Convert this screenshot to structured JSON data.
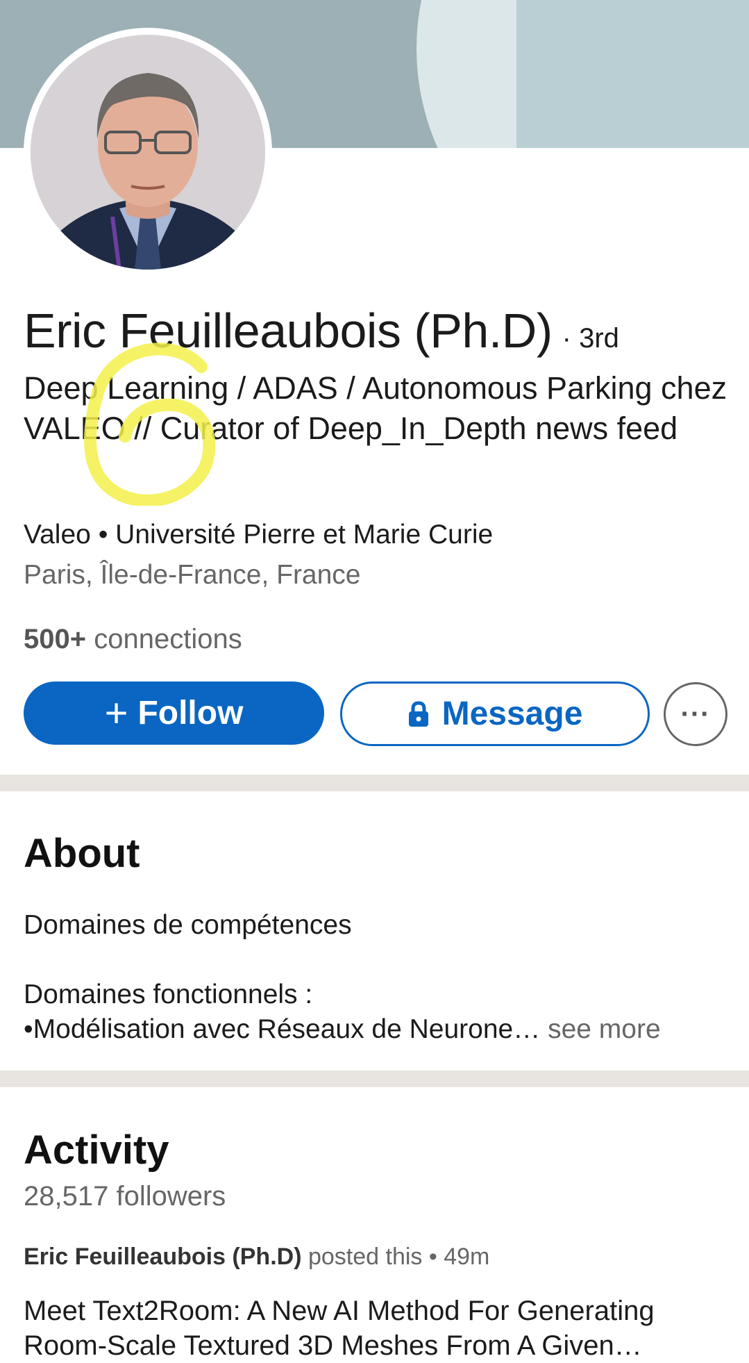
{
  "profile": {
    "name": "Eric Feuilleaubois (Ph.D)",
    "degree": "· 3rd",
    "headline": "Deep Learning / ADAS / Autonomous Parking chez VALEO // Curator of Deep_In_Depth news feed",
    "orgs": "Valeo • Université Pierre et Marie Curie",
    "location": "Paris, Île-de-France, France",
    "connections_count": "500+",
    "connections_label": "connections"
  },
  "actions": {
    "follow_icon": "+",
    "follow_label": "Follow",
    "message_label": "Message",
    "more_label": "···"
  },
  "icons": {
    "follow": "plus-icon",
    "message": "lock-icon",
    "more": "ellipsis-icon"
  },
  "about": {
    "title": "About",
    "line1": "Domaines de compétences",
    "line2": "Domaines fonctionnels :",
    "line3": "•Modélisation avec Réseaux de Neurone…",
    "see_more": "see more"
  },
  "activity": {
    "title": "Activity",
    "followers": "28,517 followers",
    "post_author": "Eric Feuilleaubois (Ph.D)",
    "post_meta": "posted this • 49m",
    "post_text": "Meet Text2Room: A New AI Method For Generating Room-Scale Textured 3D Meshes From A Given…"
  },
  "colors": {
    "brand_blue": "#0a66c2",
    "banner": "#9cb0b5",
    "divider": "#e8e4df",
    "highlight_scribble": "#f3f04a"
  }
}
